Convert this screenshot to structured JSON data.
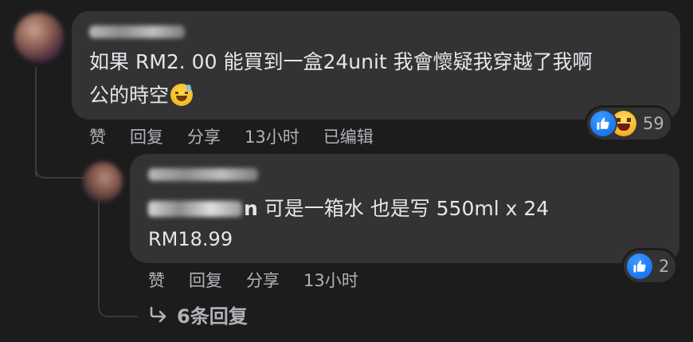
{
  "comment": {
    "text_line1": "如果 RM2. 00 能買到一盒24unit 我會懷疑我穿越了我啊",
    "text_line2": "公的時空",
    "emoji": "sweat-smile-emoji",
    "actions": {
      "like": "赞",
      "reply": "回复",
      "share": "分享",
      "time": "13小时",
      "edited": "已编辑"
    },
    "reactions": {
      "types": [
        "like-icon",
        "haha-icon"
      ],
      "count": "59"
    }
  },
  "reply": {
    "mention_suffix": "n",
    "text_line1": " 可是一箱水 也是写 550ml x 24",
    "text_line2": "RM18.99",
    "actions": {
      "like": "赞",
      "reply": "回复",
      "share": "分享",
      "time": "13小时"
    },
    "reactions": {
      "types": [
        "like-icon"
      ],
      "count": "2"
    }
  },
  "view_replies": {
    "label": "6条回复"
  },
  "colors": {
    "background": "#1c1c1d",
    "bubble": "#333334",
    "text": "#e4e6eb",
    "secondary_text": "#b0b3b8",
    "like_blue": "#1877f2"
  }
}
